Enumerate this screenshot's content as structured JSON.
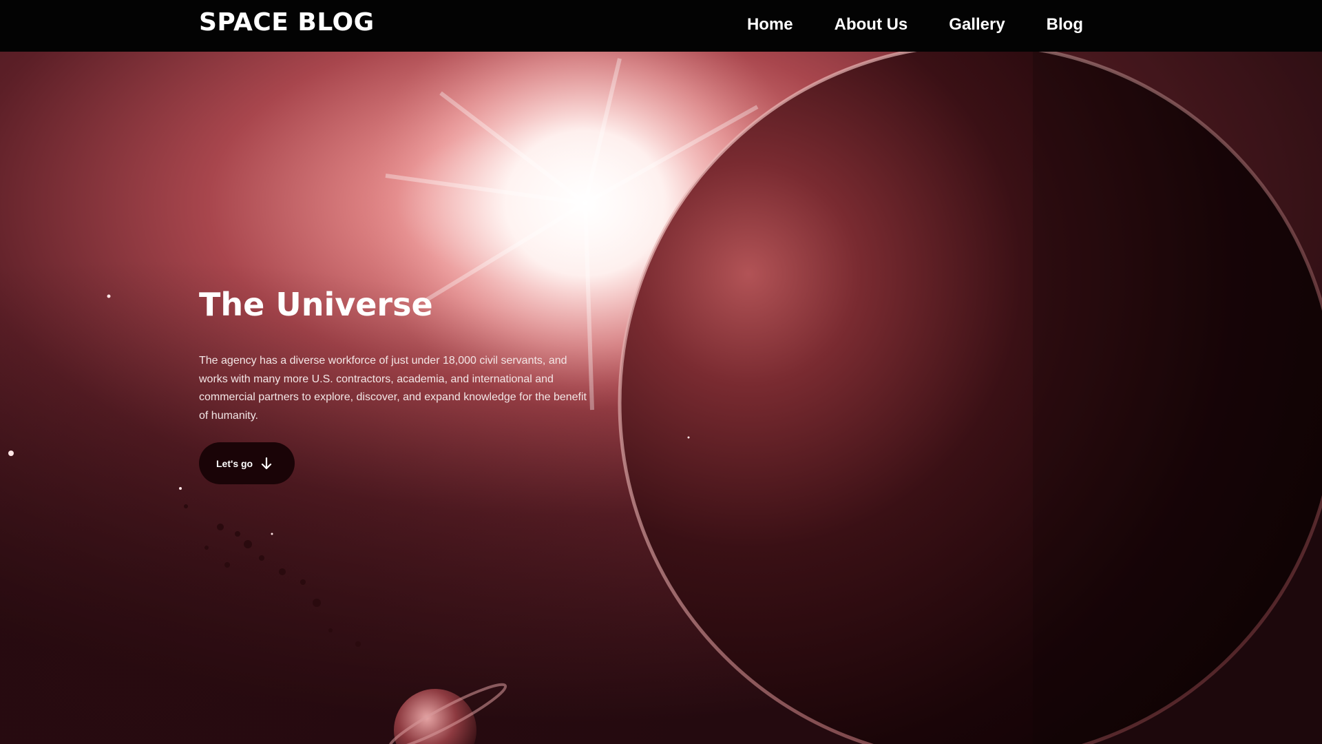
{
  "header": {
    "logo": "SPACE BLOG",
    "nav": [
      {
        "label": "Home"
      },
      {
        "label": "About Us"
      },
      {
        "label": "Gallery"
      },
      {
        "label": "Blog"
      }
    ]
  },
  "hero": {
    "title": "The Universe",
    "text": "The agency has a diverse workforce of just under 18,000 civil servants, and works with many more U.S. contractors, academia, and international and commercial partners to explore, discover, and expand knowledge for the benefit of humanity.",
    "button_label": "Let's go",
    "button_icon": "arrow-down-icon"
  },
  "colors": {
    "header_bg": "#030303",
    "button_bg": "#1a0407",
    "text": "#ffffff"
  }
}
